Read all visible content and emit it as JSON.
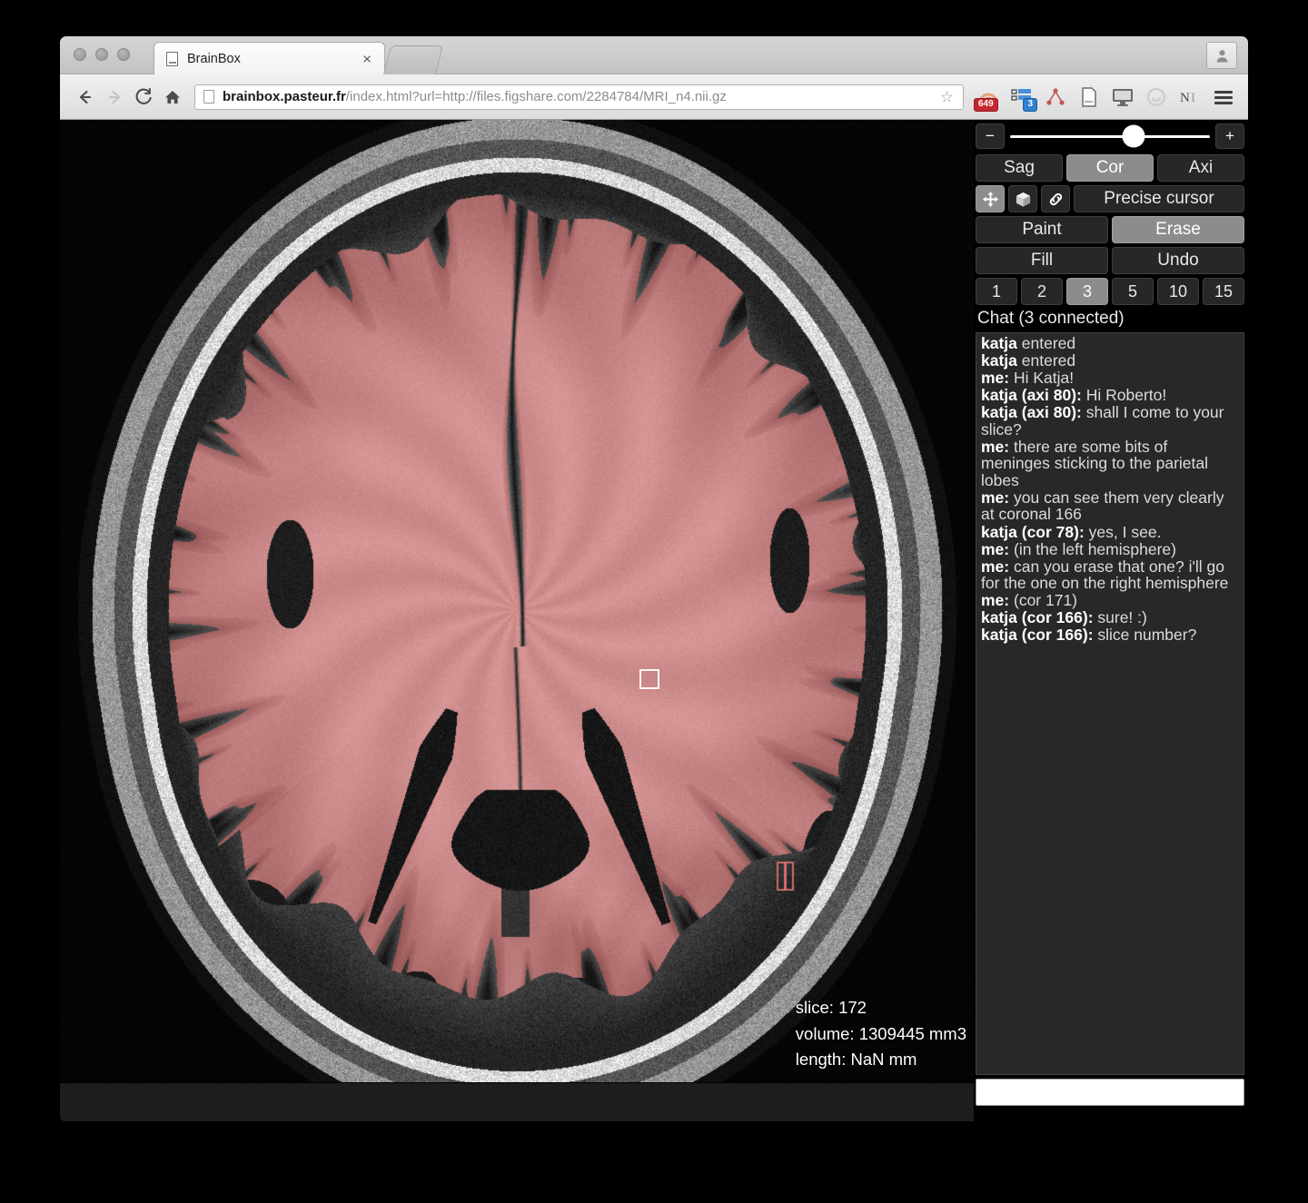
{
  "browser": {
    "tab": {
      "title": "BrainBox",
      "favicon": "document-icon",
      "close": "×"
    },
    "omnibox": {
      "domain": "brainbox.pasteur.fr",
      "path": "/index.html?url=http://files.figshare.com/2284784/MRI_n4.nii.gz",
      "full_url": "brainbox.pasteur.fr/index.html?url=http://files.figshare.com/2284784/MRI_n4.nii.gz"
    },
    "nav": {
      "back": "←",
      "forward": "→",
      "reload": "↻",
      "home": "⌂"
    },
    "extensions": [
      {
        "name": "adblock-icon",
        "badge": "649"
      },
      {
        "name": "grid-list-icon",
        "badge": "3"
      },
      {
        "name": "network-graph-icon",
        "badge": ""
      },
      {
        "name": "page-icon",
        "badge": ""
      },
      {
        "name": "monitor-icon",
        "badge": ""
      },
      {
        "name": "circle-loop-icon",
        "badge": ""
      },
      {
        "name": "nature-journal-icon",
        "badge": ""
      },
      {
        "name": "menu-icon",
        "badge": ""
      }
    ],
    "profile": "avatar-icon"
  },
  "panel": {
    "zoom": {
      "minus": "−",
      "plus": "+",
      "value_pct": 62
    },
    "planes": [
      {
        "label": "Sag",
        "active": false
      },
      {
        "label": "Cor",
        "active": true
      },
      {
        "label": "Axi",
        "active": false
      }
    ],
    "tools": [
      {
        "name": "move-icon",
        "active": true
      },
      {
        "name": "cube-icon",
        "active": false
      },
      {
        "name": "link-icon",
        "active": false
      }
    ],
    "precise_cursor": "Precise cursor",
    "actions": [
      {
        "label": "Paint",
        "active": false
      },
      {
        "label": "Erase",
        "active": true
      },
      {
        "label": "Fill",
        "active": false
      },
      {
        "label": "Undo",
        "active": false
      }
    ],
    "brush_sizes": [
      {
        "label": "1",
        "active": false
      },
      {
        "label": "2",
        "active": false
      },
      {
        "label": "3",
        "active": true
      },
      {
        "label": "5",
        "active": false
      },
      {
        "label": "10",
        "active": false
      },
      {
        "label": "15",
        "active": false
      }
    ]
  },
  "chat": {
    "title": "Chat (3 connected)",
    "input_value": "",
    "messages": [
      {
        "author": "katja",
        "text": " entered"
      },
      {
        "author": "katja",
        "text": " entered"
      },
      {
        "author": "me:",
        "text": " Hi Katja!"
      },
      {
        "author": "katja (axi 80):",
        "text": " Hi Roberto!"
      },
      {
        "author": "katja (axi 80):",
        "text": " shall I come to your slice?"
      },
      {
        "author": "me:",
        "text": " there are some bits of meninges sticking to the parietal lobes"
      },
      {
        "author": "me:",
        "text": " you can see them very clearly at coronal 166"
      },
      {
        "author": "katja (cor 78):",
        "text": " yes, I see."
      },
      {
        "author": "me:",
        "text": " (in the left hemisphere)"
      },
      {
        "author": "me:",
        "text": " can you erase that one? i'll go for the one on the right hemisphere"
      },
      {
        "author": "me:",
        "text": " (cor 171)"
      },
      {
        "author": "katja (cor 166):",
        "text": " sure! :)"
      },
      {
        "author": "katja (cor 166):",
        "text": " slice number?"
      }
    ]
  },
  "viewer": {
    "slice_label": "slice: 172",
    "volume_label": "volume: 1309445 mm3",
    "length_label": "length: NaN mm",
    "overlay_color": "#e58585",
    "background_color": "#000000"
  }
}
